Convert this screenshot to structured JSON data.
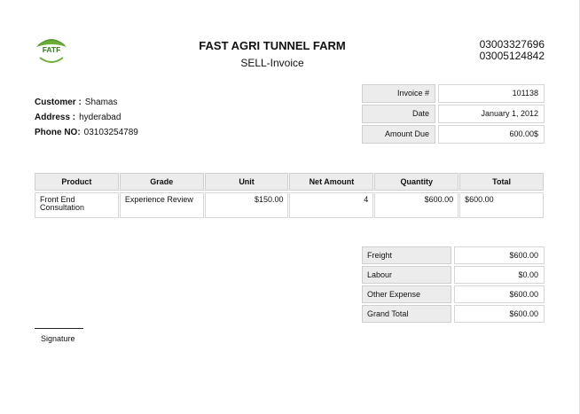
{
  "logo": {
    "text": "FATF",
    "tagline": "FAST AGRI TUNNEL FARM",
    "colors": {
      "leaf": "#6cae3a",
      "leaf_dark": "#4f8f2a"
    }
  },
  "header": {
    "company_name": "FAST AGRI TUNNEL FARM",
    "document_type": "SELL-Invoice",
    "phones": [
      "03003327696",
      "03005124842"
    ]
  },
  "customer": {
    "name_label": "Customer :",
    "name": "Shamas",
    "address_label": "Address :",
    "address": "hyderabad",
    "phone_label": "Phone NO:",
    "phone": "03103254789"
  },
  "invoice_meta": [
    {
      "label": "Invoice #",
      "value": "101138"
    },
    {
      "label": "Date",
      "value": "January 1, 2012"
    },
    {
      "label": "Amount Due",
      "value": "600.00$"
    }
  ],
  "items": {
    "headers": [
      "Product",
      "Grade",
      "Unit",
      "Net Amount",
      "Quantity",
      "Total"
    ],
    "rows": [
      {
        "product": "Front End Consultation",
        "grade": "Experience Review",
        "unit": "$150.00",
        "net_amount": "4",
        "quantity": "$600.00",
        "total": "$600.00"
      }
    ]
  },
  "totals": [
    {
      "label": "Freight",
      "value": "$600.00"
    },
    {
      "label": "Labour",
      "value": "$0.00"
    },
    {
      "label": "Other Expense",
      "value": "$600.00"
    },
    {
      "label": "Grand Total",
      "value": "$600.00"
    }
  ],
  "signature": {
    "label": "Signature"
  }
}
